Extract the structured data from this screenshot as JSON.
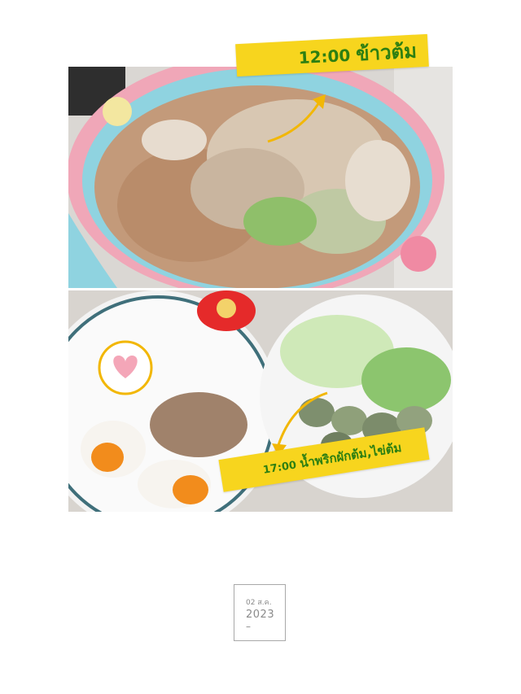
{
  "entries": [
    {
      "time": "12:00",
      "title": "ข้าวต้ม"
    },
    {
      "time": "17:00",
      "title": "น้ำพริกผักต้ม,ไข่ต้ม"
    }
  ],
  "date": {
    "day_month": "02 ส.ค.",
    "year": "2023",
    "dash": "–"
  },
  "colors": {
    "banner_bg": "#f7d51e",
    "banner_text": "#2d7f12",
    "arrow": "#f2b705"
  },
  "icons": {
    "arrow_top": "curved-arrow-icon",
    "arrow_bottom": "curved-arrow-icon",
    "heart": "heart-icon"
  }
}
